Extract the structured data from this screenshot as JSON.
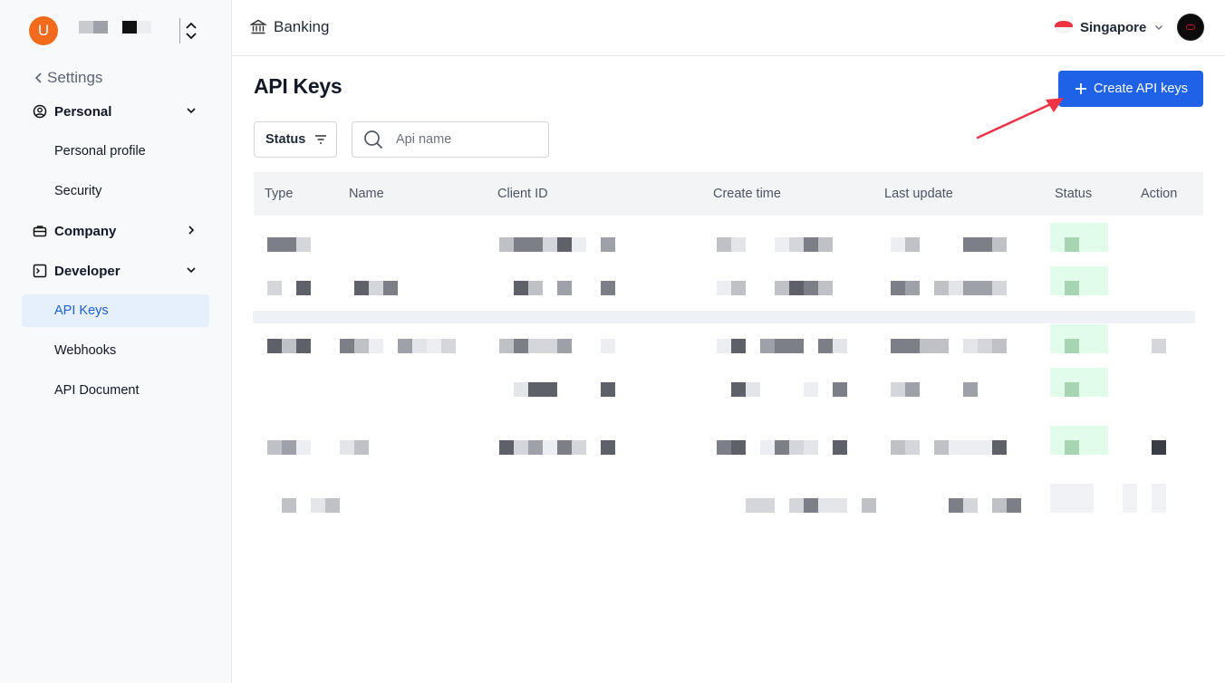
{
  "sidebar": {
    "avatar_initial": "U",
    "back_label": "Settings",
    "groups": [
      {
        "label": "Personal",
        "icon": "user-circle-icon",
        "expanded": true
      },
      {
        "label": "Company",
        "icon": "briefcase-icon",
        "expanded": false
      },
      {
        "label": "Developer",
        "icon": "terminal-icon",
        "expanded": true
      }
    ],
    "items": {
      "personal_profile": "Personal profile",
      "security": "Security",
      "api_keys": "API Keys",
      "webhooks": "Webhooks",
      "api_document": "API Document"
    },
    "active_item": "API Keys"
  },
  "header": {
    "section": "Banking",
    "section_icon": "bank-icon",
    "region": "Singapore",
    "region_flag": "singapore-flag-icon"
  },
  "main": {
    "title": "API Keys",
    "create_button": "Create API keys",
    "status_filter": "Status",
    "search_placeholder": "Api name",
    "columns": [
      "Type",
      "Name",
      "Client ID",
      "Create time",
      "Last update",
      "Status",
      "Action"
    ]
  },
  "colors": {
    "accent": "#1f62e8",
    "active_bg": "#e6f0fc",
    "avatar": "#f26b1d",
    "annotation_arrow": "#ef3344",
    "status_green": "#dcfce7"
  }
}
